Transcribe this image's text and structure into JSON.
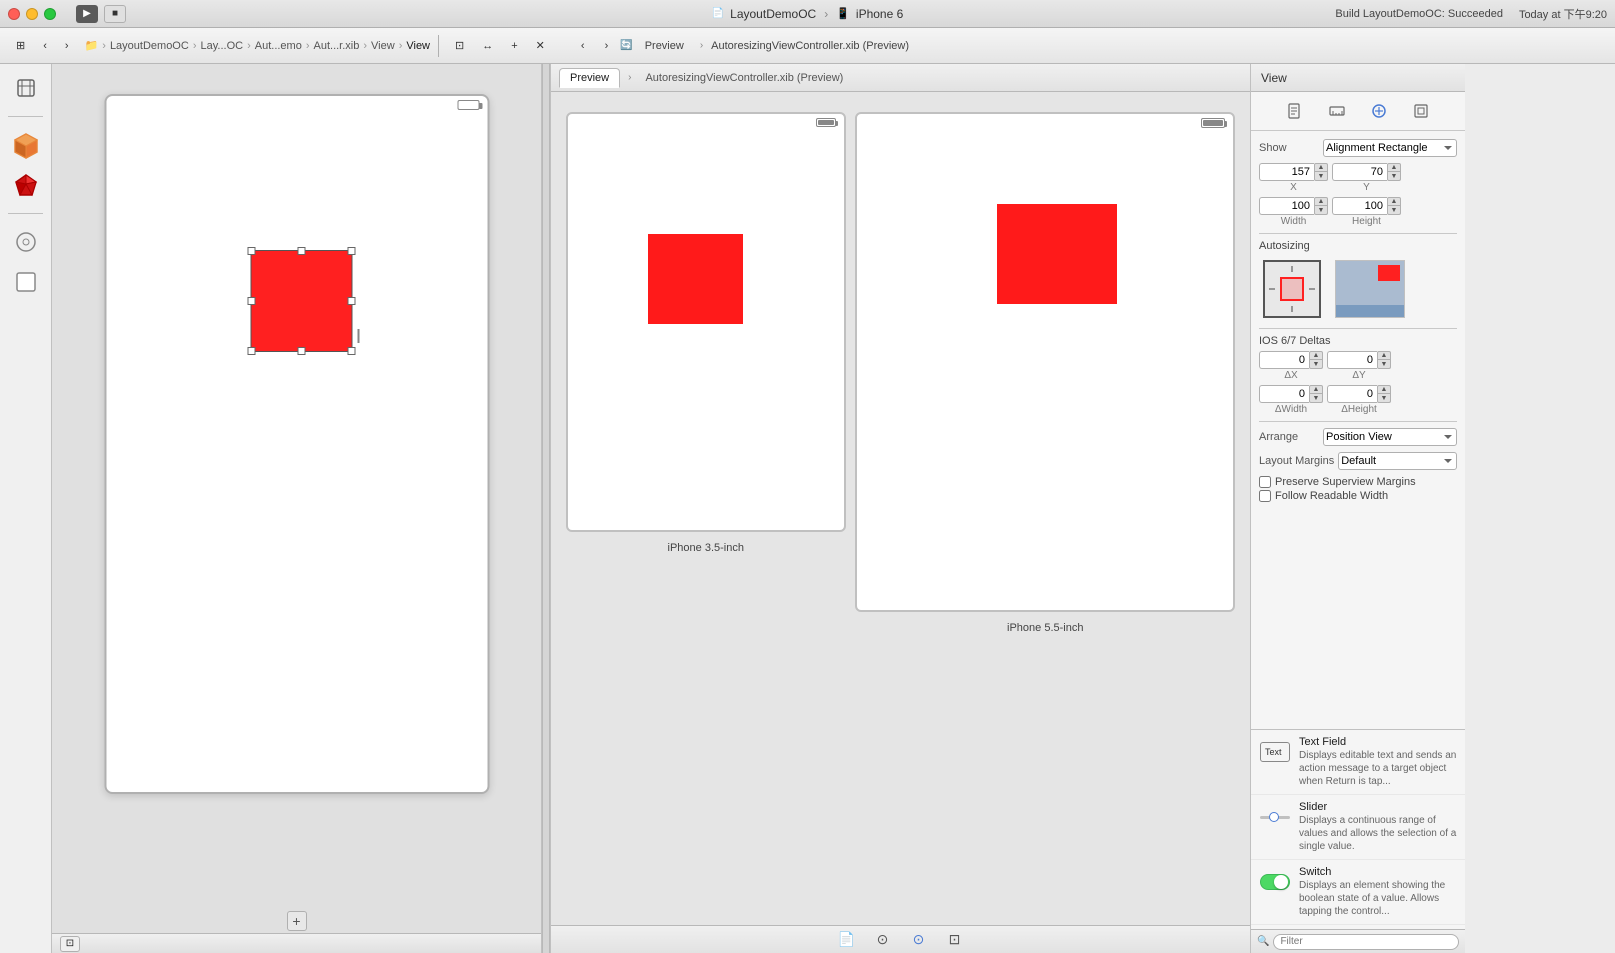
{
  "titleBar": {
    "appName": "LayoutDemoOC",
    "deviceName": "iPhone 6",
    "buildStatus": "Build LayoutDemoOC: Succeeded",
    "buildTime": "Today at 下午9:20"
  },
  "toolbar": {
    "breadcrumbs": [
      "LayoutDemoOC",
      "Lay...OC",
      "Aut...emo",
      "Aut...r.xib",
      "View",
      "View"
    ],
    "previewTab": "Preview",
    "previewFile": "AutoresizingViewController.xib (Preview)"
  },
  "rightPanel": {
    "header": "View",
    "showLabel": "Show",
    "showValue": "Alignment Rectangle",
    "xLabel": "X",
    "xValue": "157",
    "yLabel": "Y",
    "yValue": "70",
    "widthLabel": "Width",
    "widthValue": "100",
    "heightLabel": "Height",
    "heightValue": "100",
    "autosizingLabel": "Autosizing",
    "ios67Label": "IOS 6/7 Deltas",
    "deltaXLabel": "ΔX",
    "deltaXValue": "0",
    "deltaYLabel": "ΔY",
    "deltaYValue": "0",
    "deltaWidthLabel": "ΔWidth",
    "deltaWidthValue": "0",
    "deltaHeightLabel": "ΔHeight",
    "deltaHeightValue": "0",
    "arrangeLabel": "Arrange",
    "arrangeValue": "Position View",
    "layoutMarginsLabel": "Layout Margins",
    "layoutMarginsValue": "Default",
    "preserveLabel": "Preserve Superview Margins",
    "followLabel": "Follow Readable Width"
  },
  "objectLibrary": {
    "items": [
      {
        "title": "Text Field",
        "icon": "T",
        "description": "Displays editable text and sends an action message to a target object when Return is tap..."
      },
      {
        "title": "Slider",
        "icon": "—",
        "description": "Displays a continuous range of values and allows the selection of a single value."
      },
      {
        "title": "Switch",
        "icon": "⊙",
        "description": "Displays an element showing the boolean state of a value. Allows tapping the control..."
      }
    ],
    "filterPlaceholder": "Filter"
  },
  "previewDevices": [
    {
      "label": "iPhone 3.5-inch"
    },
    {
      "label": "iPhone 5.5-inch"
    }
  ]
}
